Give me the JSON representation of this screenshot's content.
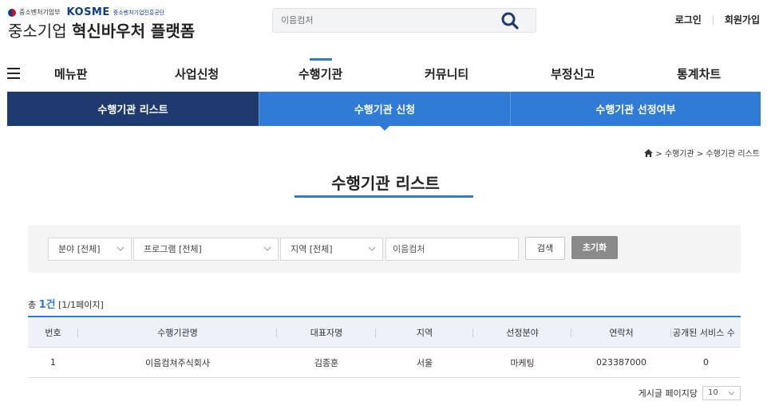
{
  "header": {
    "gov_label": "중소벤처기업부",
    "kosme_label": "KOSME",
    "kosme_sub": "중소벤처기업진흥공단",
    "site_title_prefix": "중소기업",
    "site_title_bold": "혁신바우처 플랫폼",
    "search_placeholder": "이음컴처",
    "login": "로그인",
    "signup": "회원가입"
  },
  "nav": {
    "items": [
      "메뉴판",
      "사업신청",
      "수행기관",
      "커뮤니티",
      "부정신고",
      "통계차트"
    ],
    "active": "수행기관"
  },
  "subnav": {
    "tabs": [
      "수행기관 리스트",
      "수행기관 신청",
      "수행기관 선정여부"
    ]
  },
  "breadcrumb": {
    "text": "> 수행기관 > 수행기관 리스트"
  },
  "page_title": "수행기관 리스트",
  "filters": {
    "field": "분야 [전체]",
    "program": "프로그램 [전체]",
    "region": "지역 [전체]",
    "keyword": "이음컴처",
    "search_btn": "검색",
    "reset_btn": "초기화"
  },
  "count": {
    "prefix": "총",
    "num": "1건",
    "pages": "[1/1페이지]"
  },
  "table": {
    "headers": [
      "번호",
      "수행기관명",
      "대표자명",
      "지역",
      "선정분야",
      "연락처",
      "공개된 서비스 수"
    ],
    "rows": [
      [
        "1",
        "이음컴쳐주식회사",
        "김종훈",
        "서울",
        "마케팅",
        "023387000",
        "0"
      ]
    ]
  },
  "page_size": {
    "label": "게시글 페이지당",
    "value": "10"
  },
  "colors": {
    "accent": "#2f7bd6",
    "navy": "#1e3a6e"
  }
}
